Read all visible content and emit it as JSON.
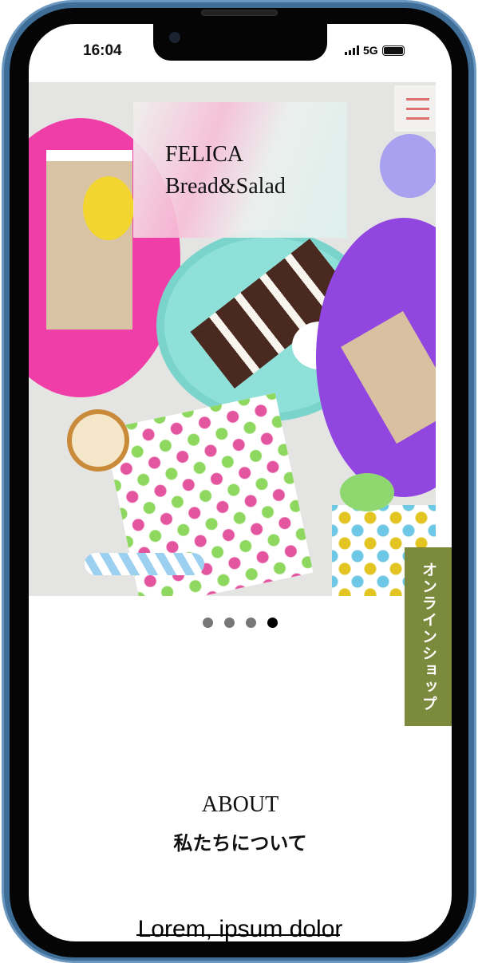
{
  "status_bar": {
    "time": "16:04",
    "network": "5G"
  },
  "header": {
    "logo_line1": "FELICA",
    "logo_line2": "Bread&Salad",
    "menu_icon": "hamburger-icon"
  },
  "carousel": {
    "slide_count": 4,
    "active_index": 4
  },
  "side_tab": {
    "label": "オンラインショップ"
  },
  "about": {
    "title_en": "ABOUT",
    "title_ja": "私たちについて",
    "body_start": "Lorem, ipsum dolor"
  },
  "colors": {
    "accent": "#7c8a3d",
    "menu_lines": "#e07070"
  }
}
